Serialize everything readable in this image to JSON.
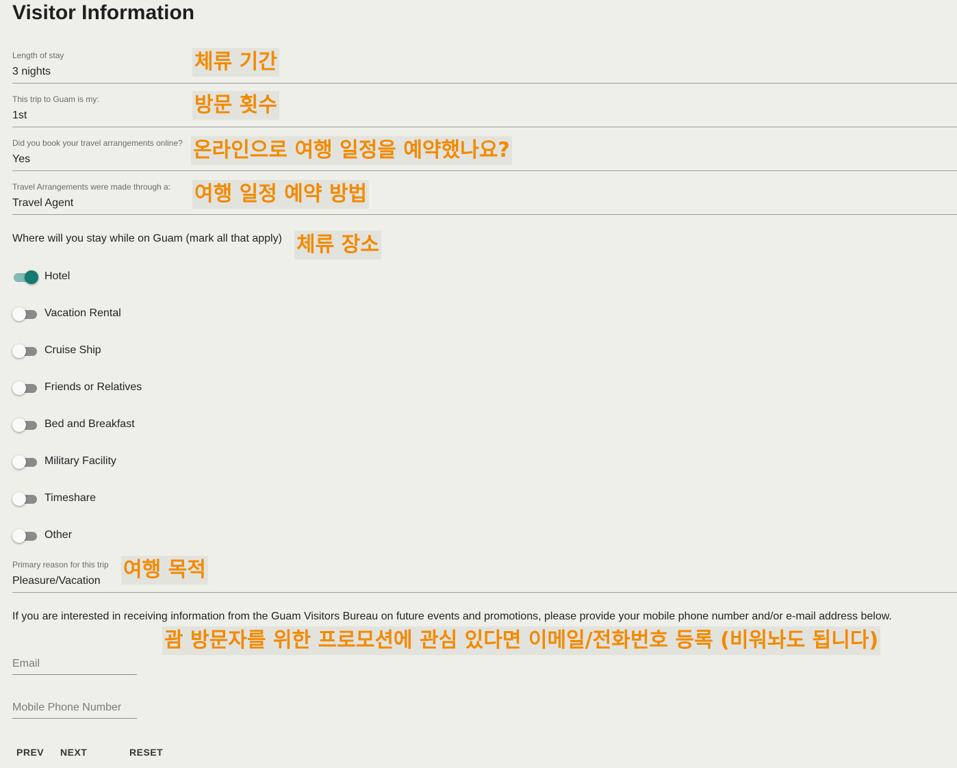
{
  "page": {
    "title": "Visitor Information"
  },
  "fields": [
    {
      "label": "Length of stay",
      "value": "3 nights",
      "annotation": "체류 기간"
    },
    {
      "label": "This trip to Guam is my:",
      "value": "1st",
      "annotation": "방문 횟수"
    },
    {
      "label": "Did you book your travel arrangements online?",
      "value": "Yes",
      "annotation": "온라인으로 여행 일정을 예약했나요?"
    },
    {
      "label": "Travel Arrangements were made through a:",
      "value": "Travel Agent",
      "annotation": "여행 일정 예약 방법"
    }
  ],
  "stay": {
    "question": "Where will you stay while on Guam (mark all that apply)",
    "annotation": "체류 장소",
    "options": [
      {
        "label": "Hotel",
        "checked": true
      },
      {
        "label": "Vacation Rental",
        "checked": false
      },
      {
        "label": "Cruise Ship",
        "checked": false
      },
      {
        "label": "Friends or Relatives",
        "checked": false
      },
      {
        "label": "Bed and Breakfast",
        "checked": false
      },
      {
        "label": "Military Facility",
        "checked": false
      },
      {
        "label": "Timeshare",
        "checked": false
      },
      {
        "label": "Other",
        "checked": false
      }
    ]
  },
  "reason": {
    "label": "Primary reason for this trip",
    "value": "Pleasure/Vacation",
    "annotation": "여행 목적"
  },
  "promo": {
    "text": "If you are interested in receiving information from the Guam Visitors Bureau on future events and promotions, please provide your mobile phone number and/or e-mail address below.",
    "annotation": "괌 방문자를 위한 프로모션에 관심 있다면 이메일/전화번호 등록 (비워놔도 됩니다)",
    "email_placeholder": "Email",
    "phone_placeholder": "Mobile Phone Number"
  },
  "buttons": {
    "prev": "PREV",
    "next": "NEXT",
    "reset": "RESET"
  },
  "colors": {
    "accent": "#157a70",
    "annotation_text": "#f28a00"
  }
}
